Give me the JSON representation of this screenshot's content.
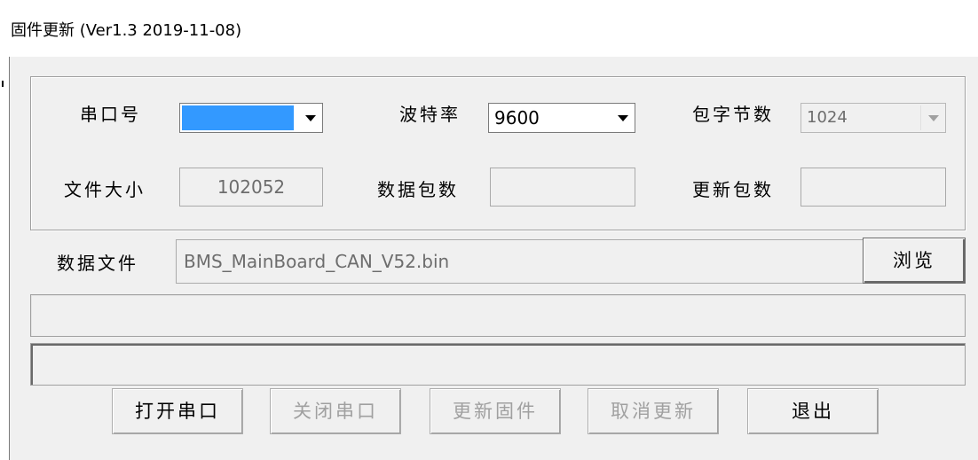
{
  "window": {
    "title": "固件更新 (Ver1.3  2019-11-08)"
  },
  "settings": {
    "port_label": "串口号",
    "port_value": "",
    "baud_label": "波特率",
    "baud_value": "9600",
    "packet_bytes_label": "包字节数",
    "packet_bytes_value": "1024",
    "file_size_label": "文件大小",
    "file_size_value": "102052",
    "data_packets_label": "数据包数",
    "data_packets_value": "",
    "update_packets_label": "更新包数",
    "update_packets_value": ""
  },
  "file": {
    "label": "数据文件",
    "path": "BMS_MainBoard_CAN_V52.bin",
    "browse_label": "浏览"
  },
  "progress": {
    "primary": 0,
    "secondary": 0
  },
  "buttons": {
    "open_port": "打开串口",
    "close_port": "关闭串口",
    "update_firmware": "更新固件",
    "cancel_update": "取消更新",
    "exit": "退出"
  },
  "icons": {
    "combo_arrow": "chevron-down-icon"
  },
  "colors": {
    "selection": "#3399ff",
    "dialog_bg": "#f0f0f0",
    "disabled_text": "#a0a0a0"
  }
}
